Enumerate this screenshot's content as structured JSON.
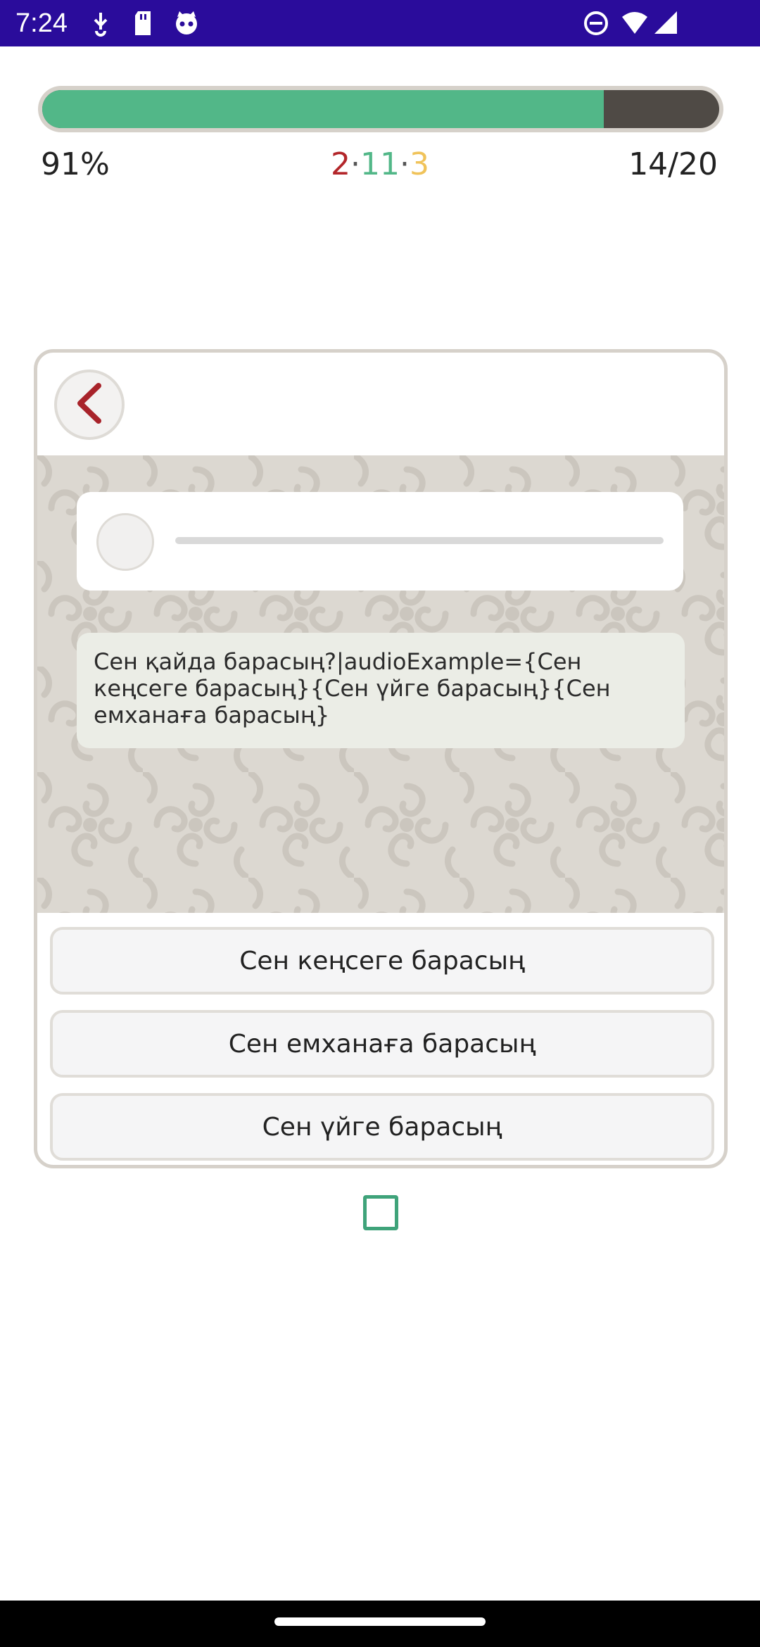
{
  "status_bar": {
    "time": "7:24",
    "icons": [
      "usb-debug-icon",
      "sd-card-icon",
      "cat-app-icon",
      "do-not-disturb-icon",
      "wifi-icon",
      "signal-icon"
    ],
    "background": "#2a0c9b"
  },
  "progress": {
    "fraction": 0.83,
    "percent_label": "91%",
    "counts": {
      "wrong": "2",
      "correct": "11",
      "skipped": "3",
      "separator": "·"
    },
    "position_label": "14/20",
    "colors": {
      "fill": "#52b788",
      "wrong": "#b3262a",
      "correct": "#52b788",
      "skipped": "#f0c35a"
    }
  },
  "card": {
    "back_icon": "chevron-left-icon",
    "audio_player": {
      "play_icon": "circle-icon"
    },
    "prompt_text": "Сен қайда барасың?|audioExample={Сен кеңсеге барасың}{Сен үйге барасың}{Сен емханаға барасың}",
    "options": [
      {
        "label": "Сен кеңсеге барасың"
      },
      {
        "label": "Сен емханаға барасың"
      },
      {
        "label": "Сен үйге барасың"
      }
    ]
  },
  "checkbox": {
    "checked": false,
    "color": "#3fa37a"
  }
}
